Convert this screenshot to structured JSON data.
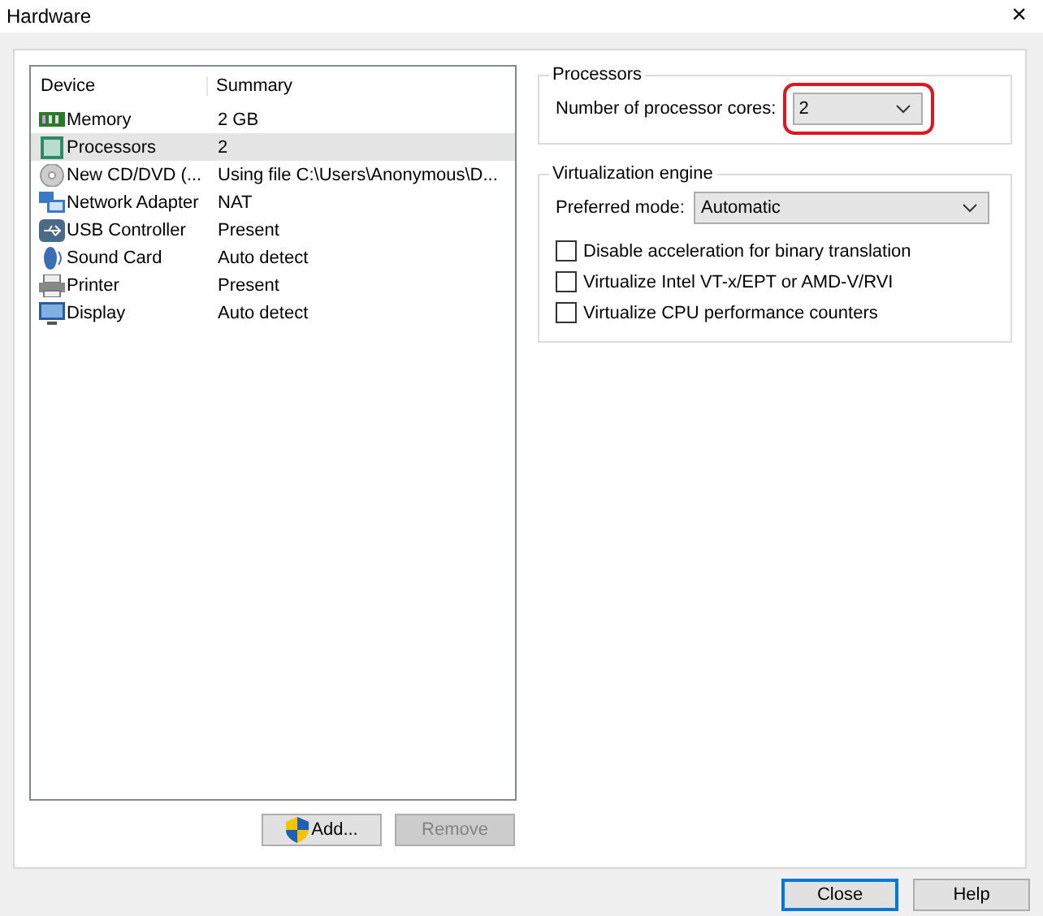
{
  "window": {
    "title": "Hardware",
    "close": "×"
  },
  "device_list": {
    "columns": [
      "Device",
      "Summary"
    ],
    "rows": [
      {
        "kind": "memory",
        "device": "Memory",
        "summary": "2 GB",
        "selected": false
      },
      {
        "kind": "processor",
        "device": "Processors",
        "summary": "2",
        "selected": true
      },
      {
        "kind": "cd",
        "device": "New CD/DVD (...",
        "summary": "Using file C:\\Users\\Anonymous\\D...",
        "selected": false
      },
      {
        "kind": "network",
        "device": "Network Adapter",
        "summary": "NAT",
        "selected": false
      },
      {
        "kind": "usb",
        "device": "USB Controller",
        "summary": "Present",
        "selected": false
      },
      {
        "kind": "sound",
        "device": "Sound Card",
        "summary": "Auto detect",
        "selected": false
      },
      {
        "kind": "printer",
        "device": "Printer",
        "summary": "Present",
        "selected": false
      },
      {
        "kind": "display",
        "device": "Display",
        "summary": "Auto detect",
        "selected": false
      }
    ]
  },
  "list_buttons": [
    {
      "label": "Add...",
      "shield": true,
      "disabled": false
    },
    {
      "label": "Remove",
      "shield": false,
      "disabled": true
    }
  ],
  "processors": {
    "title": "Processors",
    "label": "Number of processor cores:",
    "value": "2",
    "highlighted": true
  },
  "virtualization": {
    "title": "Virtualization engine",
    "mode_label": "Preferred mode:",
    "mode_value": "Automatic",
    "options": [
      {
        "label": "Disable acceleration for binary translation",
        "checked": false
      },
      {
        "label": "Virtualize Intel VT-x/EPT or AMD-V/RVI",
        "checked": false
      },
      {
        "label": "Virtualize CPU performance counters",
        "checked": false
      }
    ]
  },
  "footer_buttons": [
    {
      "label": "Close",
      "default": true
    },
    {
      "label": "Help",
      "default": false
    }
  ]
}
